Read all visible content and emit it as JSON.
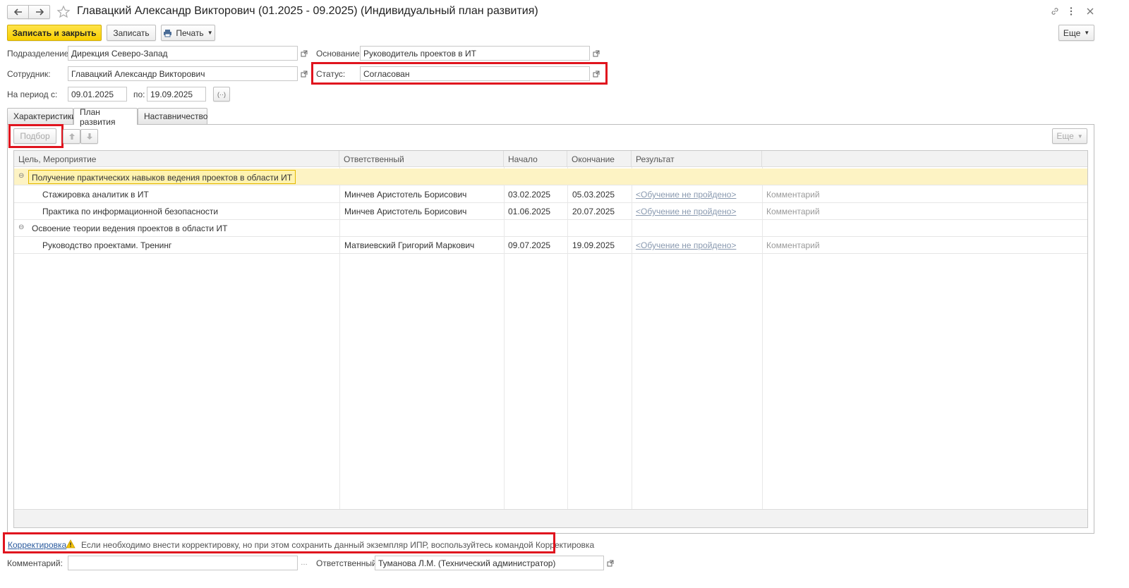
{
  "window": {
    "title": "Главацкий Александр Викторович (01.2025 - 09.2025) (Индивидуальный план развития)"
  },
  "toolbar": {
    "save_close_label": "Записать и закрыть",
    "save_label": "Записать",
    "print_label": "Печать",
    "more_label": "Еще"
  },
  "form": {
    "division_label": "Подразделение:",
    "division_value": "Дирекция Северо-Запад",
    "basis_label": "Основание:",
    "basis_value": "Руководитель проектов в ИТ",
    "employee_label": "Сотрудник:",
    "employee_value": "Главацкий Александр Викторович",
    "status_label": "Статус:",
    "status_value": "Согласован",
    "period_from_label": "На период с:",
    "period_from_value": "09.01.2025",
    "period_to_label": "по:",
    "period_to_value": "19.09.2025",
    "period_button": "(··)"
  },
  "tabs": [
    {
      "label": "Характеристики"
    },
    {
      "label": "План развития"
    },
    {
      "label": "Наставничество"
    }
  ],
  "plan_toolbar": {
    "pick_label": "Подбор",
    "more_label": "Еще"
  },
  "table": {
    "columns": [
      "Цель, Мероприятие",
      "Ответственный",
      "Начало",
      "Окончание",
      "Результат"
    ],
    "rows": [
      {
        "type": "group",
        "name": "Получение практических навыков ведения проектов в области ИТ"
      },
      {
        "type": "item",
        "name": "Стажировка аналитик в ИТ",
        "responsible": "Минчев Аристотель Борисович",
        "start": "03.02.2025",
        "end": "05.03.2025",
        "result": "<Обучение не пройдено>",
        "comment": "Комментарий"
      },
      {
        "type": "item",
        "name": "Практика по информационной безопасности",
        "responsible": "Минчев Аристотель Борисович",
        "start": "01.06.2025",
        "end": "20.07.2025",
        "result": "<Обучение не пройдено>",
        "comment": "Комментарий"
      },
      {
        "type": "group",
        "name": "Освоение теории ведения проектов в области ИТ"
      },
      {
        "type": "item",
        "name": "Руководство проектами. Тренинг",
        "responsible": "Матвиевский Григорий Маркович",
        "start": "09.07.2025",
        "end": "19.09.2025",
        "result": "<Обучение не пройдено>",
        "comment": "Комментарий"
      }
    ]
  },
  "footer": {
    "correction_link": "Корректировка",
    "correction_hint": "Если необходимо внести корректировку, но при этом сохранить данный экземпляр ИПР, воспользуйтесь командой Корректировка",
    "comment_label": "Комментарий:",
    "comment_value": "",
    "responsible_label": "Ответственный:",
    "responsible_value": "Туманова Л.М. (Технический администратор)"
  },
  "colors": {
    "highlight": "#e0141e",
    "primary_button": "#f8cf00",
    "selected_row": "#fdf3c4"
  }
}
